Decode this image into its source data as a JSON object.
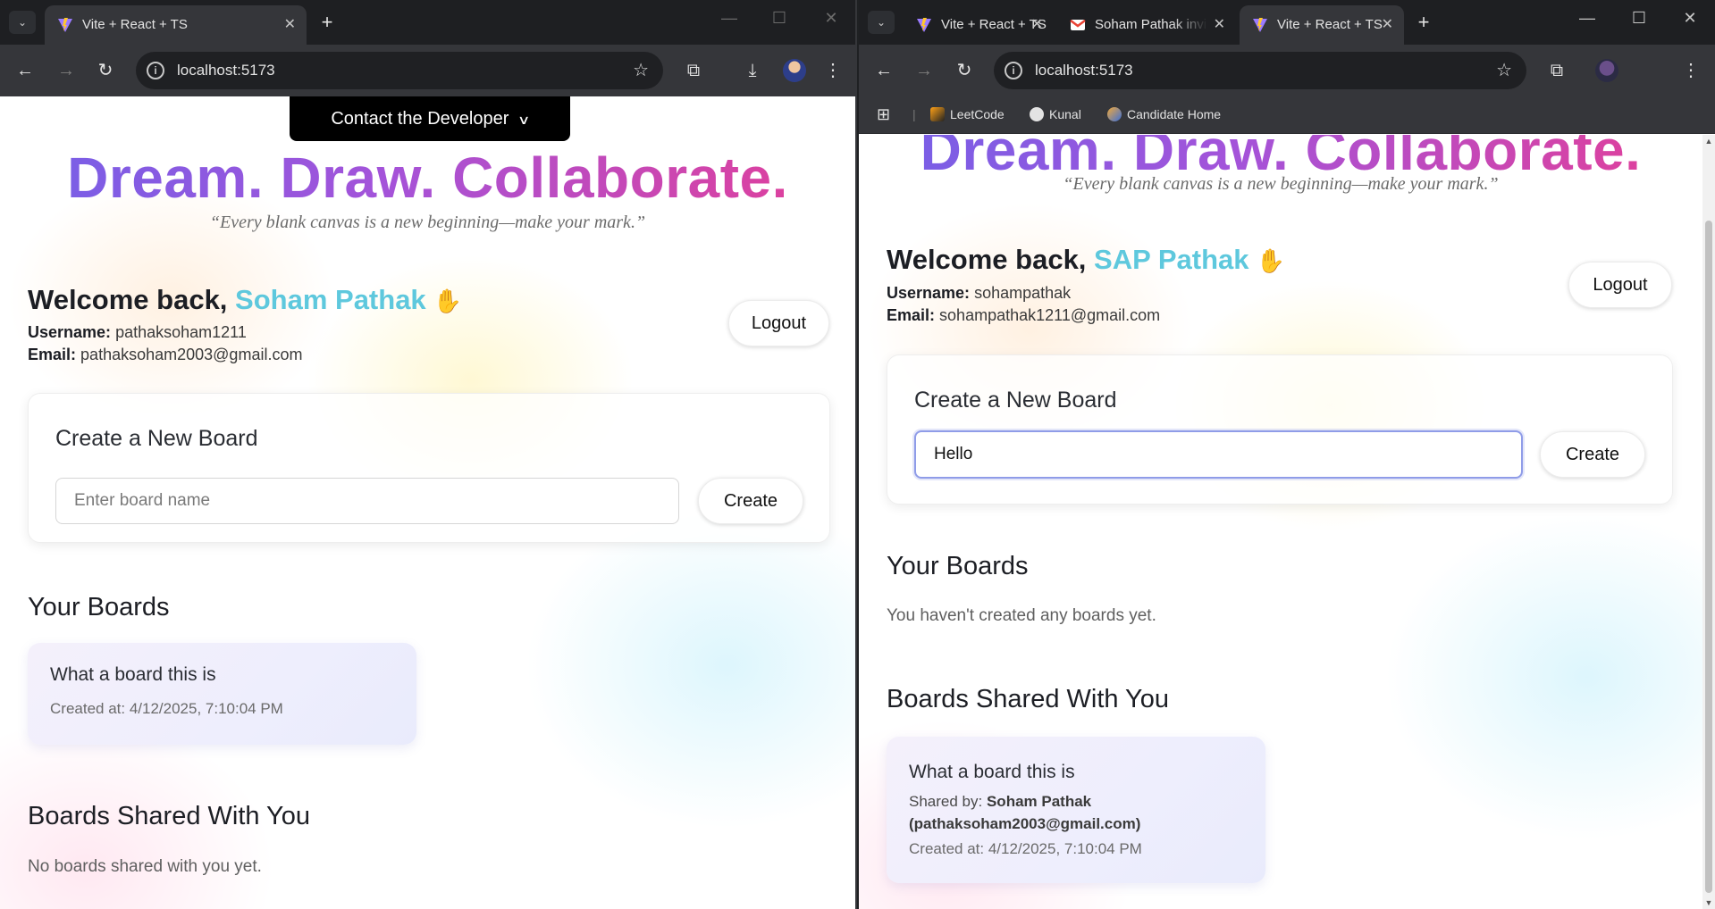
{
  "left": {
    "tabs": [
      {
        "title": "Vite + React + TS"
      }
    ],
    "url": "localhost:5173",
    "contact_label": "Contact the Developer",
    "hero": "Dream. Draw. Collaborate.",
    "quote": "“Every blank canvas is a new beginning—make your mark.”",
    "welcome_prefix": "Welcome back,",
    "user_name": "Soham Pathak",
    "username_label": "Username:",
    "username": "pathaksoham1211",
    "email_label": "Email:",
    "email": "pathaksoham2003@gmail.com",
    "logout_label": "Logout",
    "create_title": "Create a New Board",
    "create_placeholder": "Enter board name",
    "create_value": "",
    "create_button": "Create",
    "your_boards_title": "Your Boards",
    "boards": [
      {
        "title": "What a board this is",
        "created": "Created at: 4/12/2025, 7:10:04 PM"
      }
    ],
    "shared_title": "Boards Shared With You",
    "shared_empty": "No boards shared with you yet."
  },
  "right": {
    "tabs": [
      {
        "title": "Vite + React + TS"
      },
      {
        "title": "Soham Pathak invi"
      },
      {
        "title": "Vite + React + TS"
      }
    ],
    "url": "localhost:5173",
    "bookmarks": [
      {
        "label": "LeetCode"
      },
      {
        "label": "Kunal"
      },
      {
        "label": "Candidate Home"
      }
    ],
    "hero": "Dream. Draw. Collaborate.",
    "quote": "“Every blank canvas is a new beginning—make your mark.”",
    "welcome_prefix": "Welcome back,",
    "user_name": "SAP Pathak",
    "username_label": "Username:",
    "username": "sohampathak",
    "email_label": "Email:",
    "email": "sohampathak1211@gmail.com",
    "logout_label": "Logout",
    "create_title": "Create a New Board",
    "create_placeholder": "Enter board name",
    "create_value": "Hello",
    "create_button": "Create",
    "your_boards_title": "Your Boards",
    "boards_empty": "You haven't created any boards yet.",
    "shared_title": "Boards Shared With You",
    "shared_boards": [
      {
        "title": "What a board this is",
        "shared_label": "Shared by:",
        "shared_by": "Soham Pathak",
        "shared_email": "(pathaksoham2003@gmail.com)",
        "created": "Created at: 4/12/2025, 7:10:04 PM"
      }
    ]
  },
  "colors": {
    "accent_name": "#5ec8dd",
    "gradient_start": "#7360e8",
    "gradient_end": "#e53e96",
    "chrome_dark": "#35363a"
  },
  "icons": {
    "nav_back": "arrow-left-icon",
    "nav_forward": "arrow-right-icon",
    "reload": "reload-icon",
    "star": "star-icon",
    "extensions": "puzzle-icon",
    "download": "download-icon",
    "menu": "kebab-menu-icon"
  }
}
